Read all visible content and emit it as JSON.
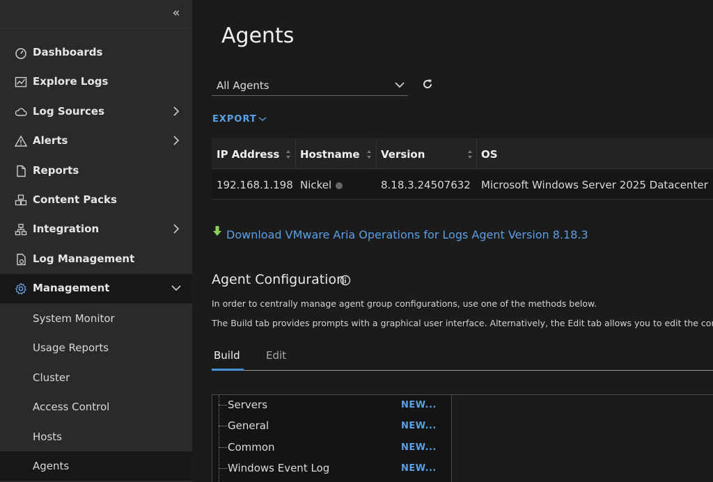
{
  "sidebar": {
    "items": [
      {
        "label": "Dashboards",
        "icon": "dashboard-icon",
        "has_chevron": false
      },
      {
        "label": "Explore Logs",
        "icon": "chart-icon",
        "has_chevron": false
      },
      {
        "label": "Log Sources",
        "icon": "cloud-icon",
        "has_chevron": true
      },
      {
        "label": "Alerts",
        "icon": "warning-icon",
        "has_chevron": true
      },
      {
        "label": "Reports",
        "icon": "document-icon",
        "has_chevron": false
      },
      {
        "label": "Content Packs",
        "icon": "packs-icon",
        "has_chevron": false
      },
      {
        "label": "Integration",
        "icon": "network-icon",
        "has_chevron": true
      },
      {
        "label": "Log Management",
        "icon": "log-gear-icon",
        "has_chevron": false
      },
      {
        "label": "Management",
        "icon": "gear-icon",
        "has_chevron": true,
        "expanded": true
      }
    ],
    "sub_items": [
      "System Monitor",
      "Usage Reports",
      "Cluster",
      "Access Control",
      "Hosts",
      "Agents"
    ],
    "active_sub": "Agents"
  },
  "main": {
    "title": "Agents",
    "filter": {
      "value": "All Agents"
    },
    "export_label": "EXPORT",
    "table": {
      "columns": [
        "IP Address",
        "Hostname",
        "Version",
        "OS"
      ],
      "rows": [
        {
          "ip": "192.168.1.198",
          "hostname": "Nickel",
          "version": "8.18.3.24507632",
          "os": "Microsoft Windows Server 2025 Datacenter"
        }
      ]
    },
    "download_link": "Download VMware Aria Operations for Logs Agent Version 8.18.3",
    "config": {
      "title": "Agent Configuration",
      "desc1": "In order to centrally manage agent group configurations, use one of the methods below.",
      "desc2": "The Build tab provides prompts with a graphical user interface. Alternatively, the Edit tab allows you to edit the configuration file directly."
    },
    "tabs": [
      "Build",
      "Edit"
    ],
    "active_tab": "Build",
    "tree": [
      {
        "name": "Servers",
        "action": "NEW..."
      },
      {
        "name": "General",
        "action": "NEW..."
      },
      {
        "name": "Common",
        "action": "NEW..."
      },
      {
        "name": "Windows Event Log",
        "action": "NEW..."
      }
    ]
  },
  "colors": {
    "sidebar_bg": "#2a2a2a",
    "main_bg": "#1b1b1b",
    "accent_link": "#5aa0e6",
    "tab_underline": "#4a90d9"
  }
}
